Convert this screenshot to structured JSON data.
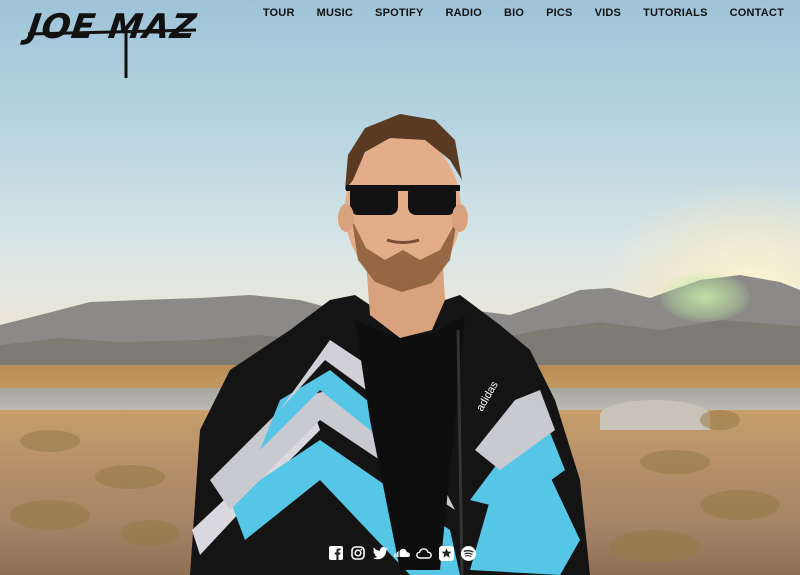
{
  "site": {
    "logo_text": "JOE MAZ"
  },
  "nav": {
    "items": [
      {
        "label": "TOUR"
      },
      {
        "label": "MUSIC"
      },
      {
        "label": "SPOTIFY"
      },
      {
        "label": "RADIO"
      },
      {
        "label": "BIO"
      },
      {
        "label": "PICS"
      },
      {
        "label": "VIDS"
      },
      {
        "label": "TUTORIALS"
      },
      {
        "label": "CONTACT"
      }
    ]
  },
  "hero": {
    "jacket_brand": "adidas"
  },
  "social": {
    "icons": [
      "facebook-icon",
      "instagram-icon",
      "twitter-icon",
      "soundcloud-icon",
      "cloud-icon",
      "star-icon",
      "spotify-icon"
    ]
  },
  "colors": {
    "nav_text": "#111111",
    "icon_color": "#ffffff",
    "jacket_blue": "#55c6e6",
    "jacket_black": "#141414"
  }
}
